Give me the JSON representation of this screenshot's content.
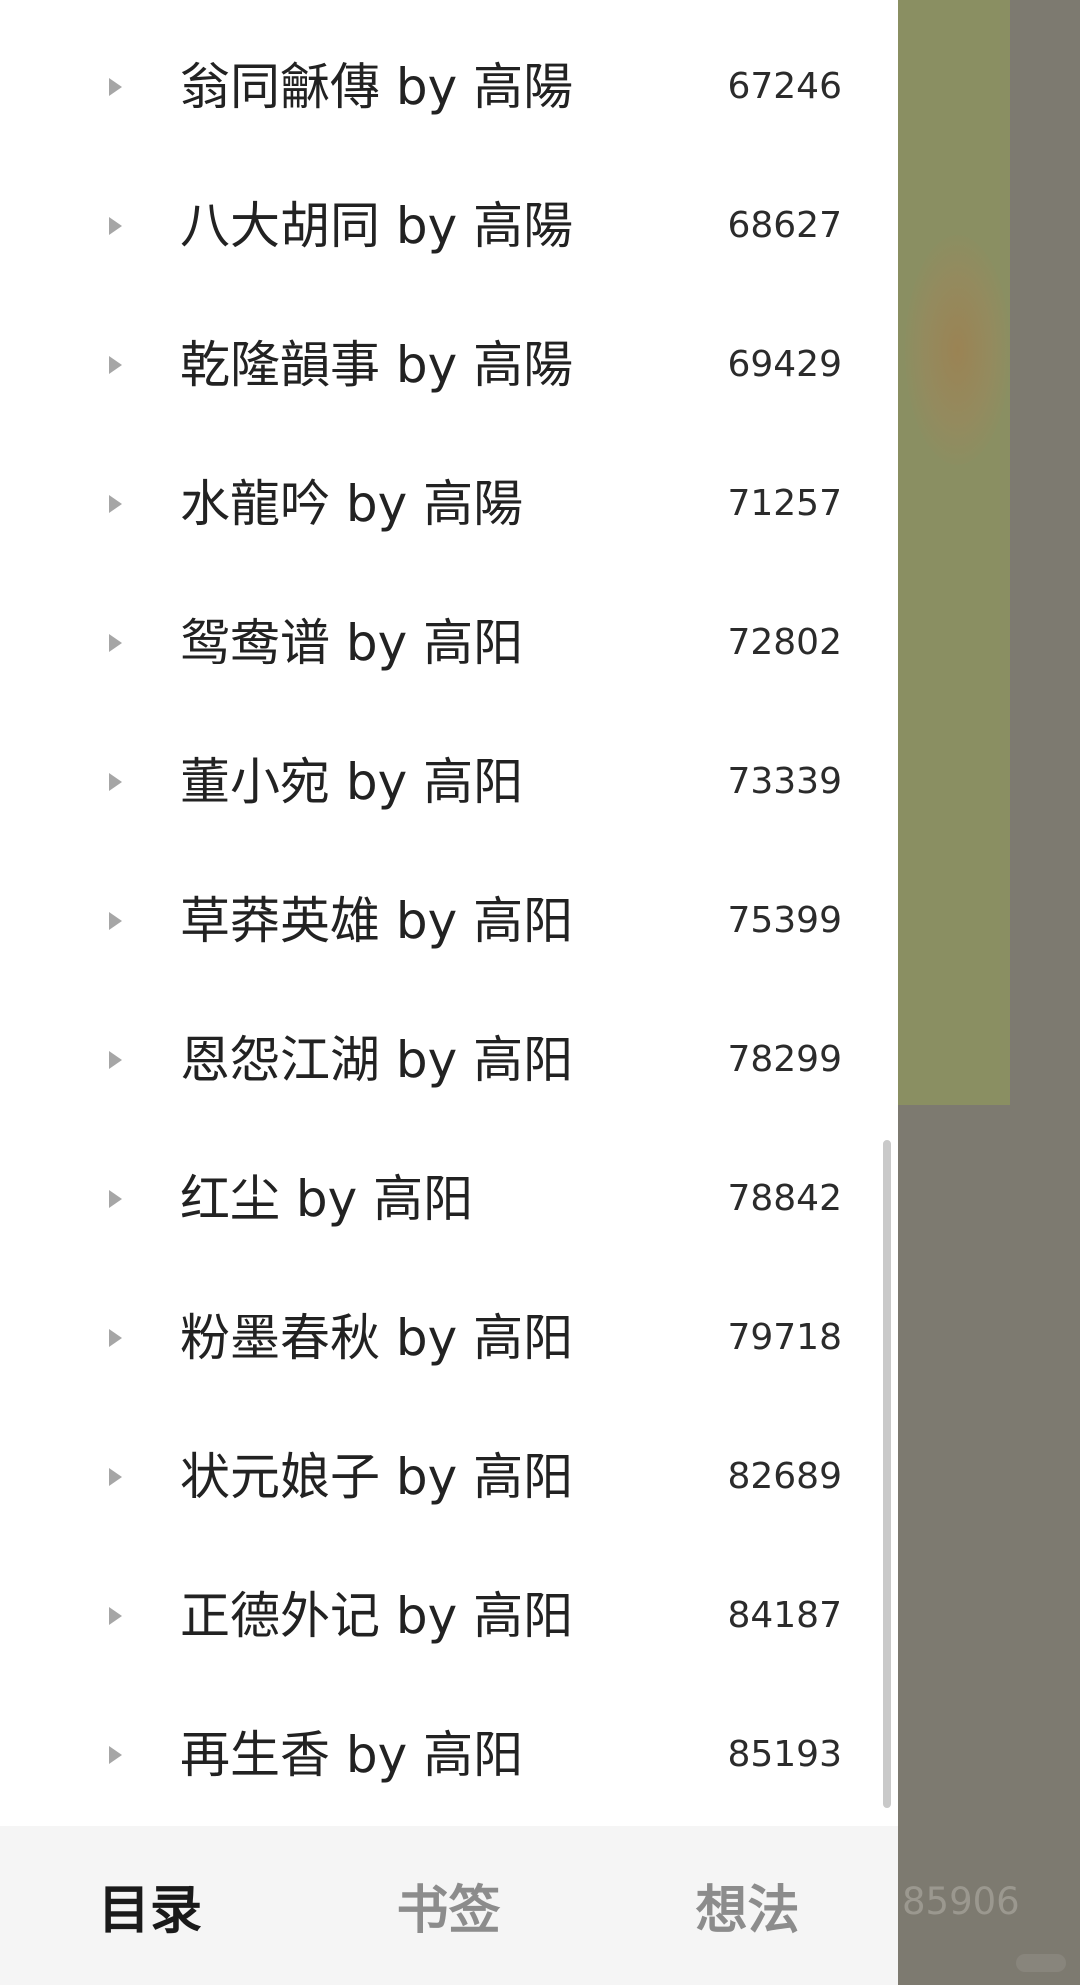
{
  "toc": {
    "items": [
      {
        "title": "翁同龢傳 by 高陽",
        "page": "67246"
      },
      {
        "title": "八大胡同 by 高陽",
        "page": "68627"
      },
      {
        "title": "乾隆韻事 by 高陽",
        "page": "69429"
      },
      {
        "title": "水龍吟 by 高陽",
        "page": "71257"
      },
      {
        "title": "鸳鸯谱 by 高阳",
        "page": "72802"
      },
      {
        "title": "董小宛 by 高阳",
        "page": "73339"
      },
      {
        "title": "草莽英雄 by 高阳",
        "page": "75399"
      },
      {
        "title": "恩怨江湖 by 高阳",
        "page": "78299"
      },
      {
        "title": "红尘 by 高阳",
        "page": "78842"
      },
      {
        "title": "粉墨春秋 by 高阳",
        "page": "79718"
      },
      {
        "title": "状元娘子 by 高阳",
        "page": "82689"
      },
      {
        "title": "正德外记 by 高阳",
        "page": "84187"
      },
      {
        "title": "再生香 by 高阳",
        "page": "85193"
      }
    ]
  },
  "tabs": [
    {
      "label": "目录",
      "active": true
    },
    {
      "label": "书签",
      "active": false
    },
    {
      "label": "想法",
      "active": false
    }
  ],
  "background": {
    "page_number": "85906"
  },
  "colors": {
    "drawer_bg": "#ffffff",
    "tab_bar_bg": "#f5f5f5",
    "active_tab": "#1a1a1a",
    "inactive_tab": "#8c8c8c",
    "dim_overlay": "#7d7a70"
  }
}
